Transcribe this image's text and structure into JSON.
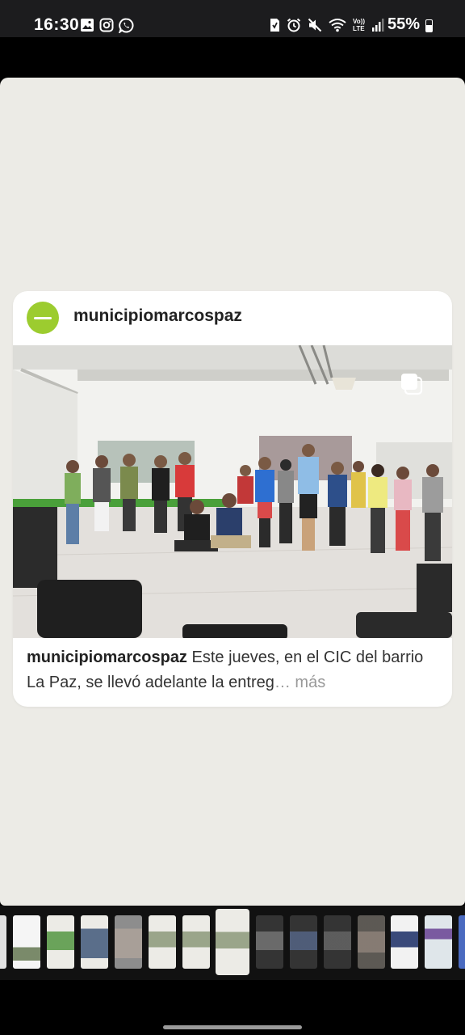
{
  "status_bar": {
    "time": "16:30",
    "battery": "55%",
    "left_icons": [
      "gallery-icon",
      "instagram-icon",
      "whatsapp-icon"
    ],
    "right_icons": [
      "save-icon",
      "alarm-icon",
      "mute-icon",
      "wifi-icon",
      "volte-icon",
      "signal-icon"
    ],
    "volte_label_top": "Vo))",
    "volte_label_bottom": "LTE"
  },
  "post": {
    "username": "municipiomarcospaz",
    "caption_user": "municipiomarcospaz",
    "caption_text": " Este jueves, en el CIC del barrio La Paz, se llevó adelante la entreg",
    "caption_ellipsis": "…",
    "caption_more": " más",
    "photo_description": "group-photo",
    "has_carousel_icon": true
  },
  "colors": {
    "viewer_bg": "#ecebe6",
    "avatar_green": "#9ccc2f",
    "username": "#222222",
    "more_gray": "#999999"
  },
  "filmstrip": {
    "count": 14,
    "active_index": 6
  }
}
